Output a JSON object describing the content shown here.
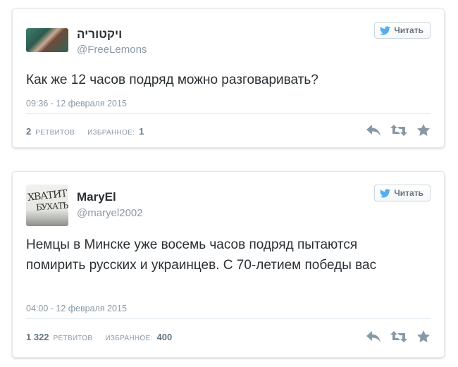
{
  "tweets": [
    {
      "display_name": "ויקטוריה",
      "handle": "@FreeLemons",
      "follow_label": "Читать",
      "text": "Как же 12 часов подряд можно разговаривать?",
      "timestamp": "09:36 - 12 февраля 2015",
      "retweets_count": "2",
      "retweets_label": "ретвитов",
      "favorites_label": "избранное:",
      "favorites_count": "1"
    },
    {
      "display_name": "MaryEl",
      "handle": "@maryel2002",
      "follow_label": "Читать",
      "avatar_text_line1": "ХВАТИТ",
      "avatar_text_line2": "БУХАТЬ",
      "text": "Немцы в Минске уже восемь часов подряд пытаются помирить русских и украинцев. С 70-летием победы вас",
      "timestamp": "04:00 - 12 февраля 2015",
      "retweets_count": "1 322",
      "retweets_label": "ретвитов",
      "favorites_label": "избранное:",
      "favorites_count": "400"
    }
  ],
  "icons": {
    "bird": "twitter-bird-icon",
    "reply": "reply-icon",
    "retweet": "retweet-icon",
    "favorite": "star-icon"
  },
  "colors": {
    "twitter_blue": "#55acee",
    "action_gray": "#8899a6",
    "text": "#292f33"
  }
}
